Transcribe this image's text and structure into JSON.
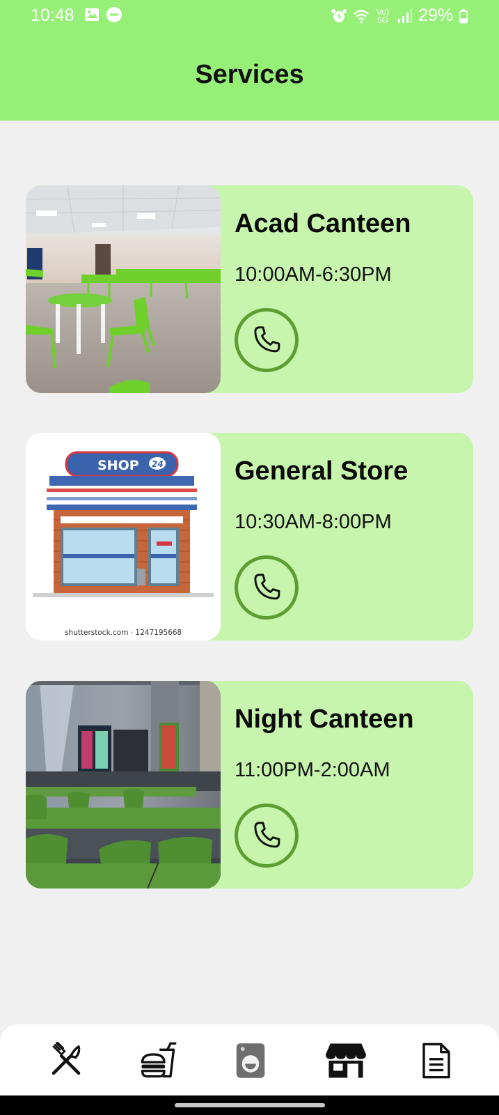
{
  "status_bar": {
    "time": "10:48",
    "network": "Vo) 5G",
    "battery": "29%"
  },
  "header": {
    "title": "Services"
  },
  "services": [
    {
      "name": "Acad Canteen",
      "hours": "10:00AM-6:30PM",
      "image": "canteen-hall-photo",
      "action_icon": "phone-icon"
    },
    {
      "name": "General Store",
      "hours": "10:30AM-8:00PM",
      "image": "shop-illustration",
      "action_icon": "phone-icon",
      "image_text": {
        "sign": "SHOP",
        "badge": "24",
        "watermark": "shutterstock.com · 1247195668"
      }
    },
    {
      "name": "Night Canteen",
      "hours": "11:00PM-2:00AM",
      "image": "night-canteen-photo",
      "action_icon": "phone-icon"
    }
  ],
  "bottom_nav": [
    {
      "icon": "fork-knife-icon"
    },
    {
      "icon": "burger-drink-icon"
    },
    {
      "icon": "washing-machine-icon"
    },
    {
      "icon": "store-icon",
      "active": true
    },
    {
      "icon": "document-icon"
    }
  ],
  "colors": {
    "header_bg": "#96ef77",
    "card_bg": "#c7f5ad",
    "call_ring": "#5d9e33",
    "page_bg": "#f0f0f0"
  }
}
